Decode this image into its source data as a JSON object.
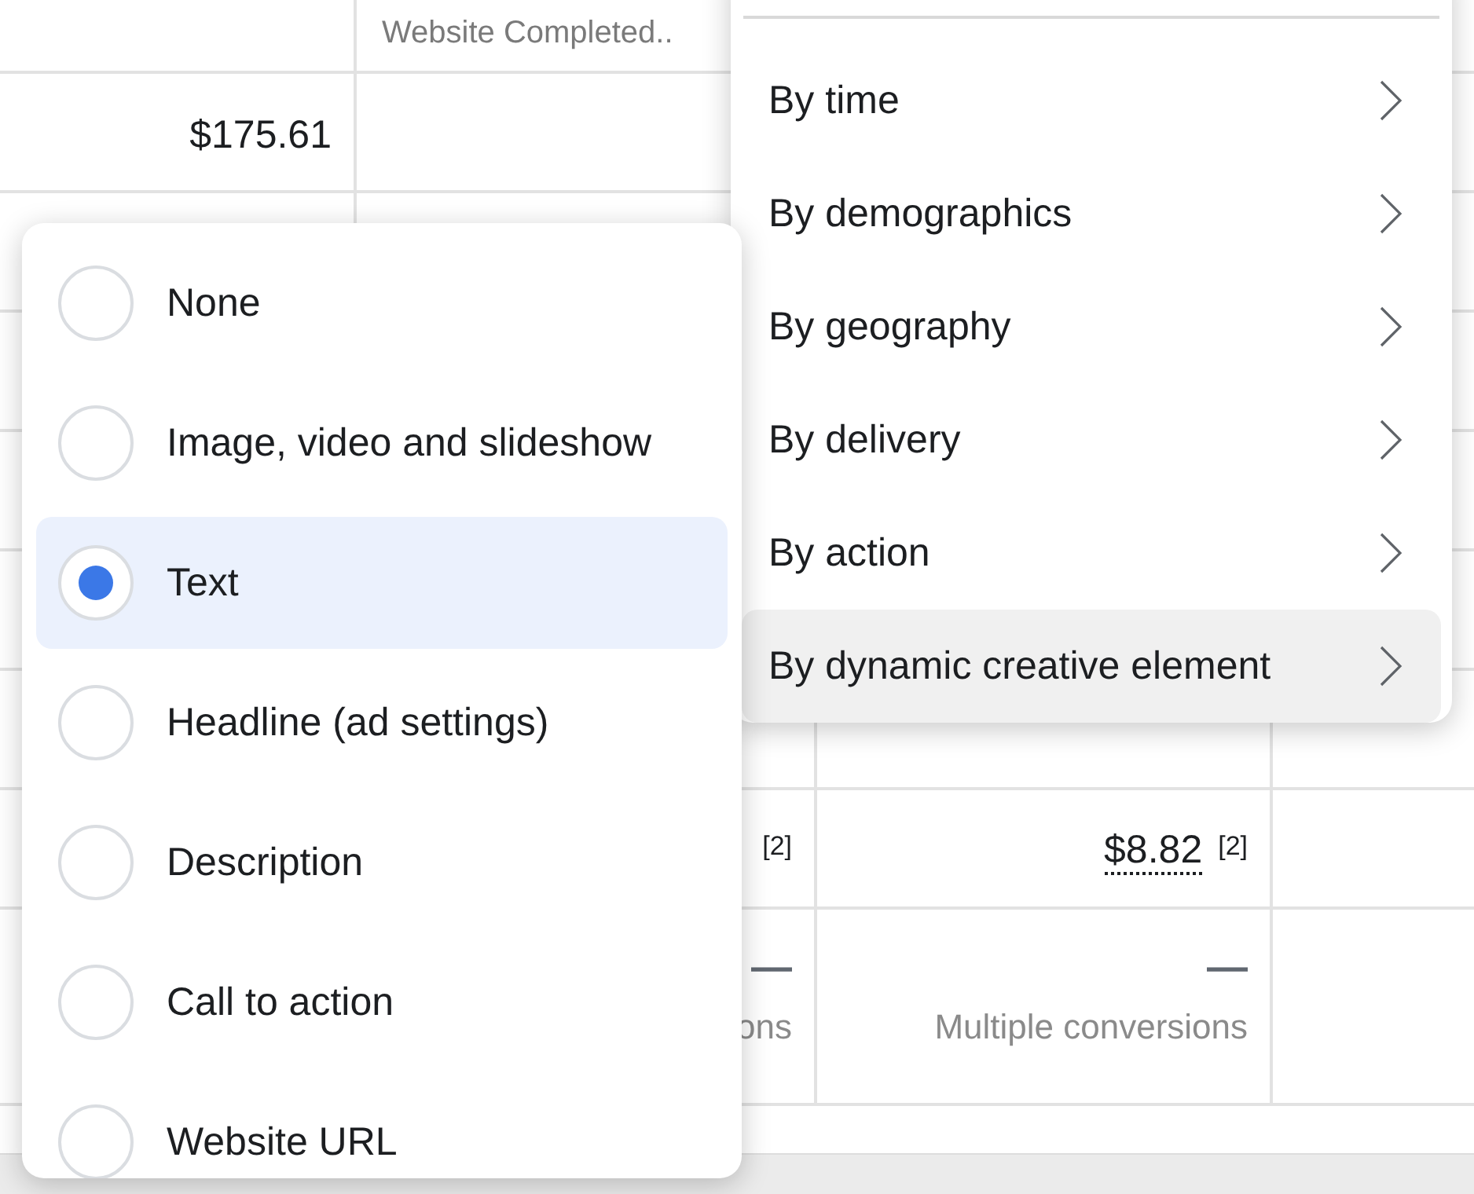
{
  "table": {
    "header": {
      "column_2": "Website Completed.."
    },
    "rows": [
      {
        "cells": [
          "$175.61",
          null,
          null,
          null
        ]
      },
      {
        "cells": [
          null,
          null,
          null,
          null
        ]
      },
      {
        "cells": [
          null,
          null,
          null,
          null
        ]
      },
      {
        "cells": [
          null,
          null,
          null,
          null
        ]
      },
      {
        "cells": [
          null,
          null,
          null,
          null
        ]
      },
      {
        "cells": [
          null,
          null,
          null,
          null
        ]
      },
      {
        "cells": [
          null,
          {
            "note": "[2]"
          },
          {
            "value": "$8.82",
            "note": "[2]"
          },
          null
        ]
      },
      {
        "cells": [
          null,
          {
            "dash": "—",
            "caption": "ons"
          },
          {
            "dash": "—",
            "caption": "Multiple conversions"
          },
          null
        ]
      }
    ]
  },
  "breakdown_menu": {
    "items": [
      {
        "label": "By time",
        "selected": false
      },
      {
        "label": "By demographics",
        "selected": false
      },
      {
        "label": "By geography",
        "selected": false
      },
      {
        "label": "By delivery",
        "selected": false
      },
      {
        "label": "By action",
        "selected": false
      },
      {
        "label": "By dynamic creative element",
        "selected": true
      }
    ]
  },
  "element_menu": {
    "items": [
      {
        "label": "None",
        "selected": false
      },
      {
        "label": "Image, video and slideshow",
        "selected": false
      },
      {
        "label": "Text",
        "selected": true
      },
      {
        "label": "Headline (ad settings)",
        "selected": false
      },
      {
        "label": "Description",
        "selected": false
      },
      {
        "label": "Call to action",
        "selected": false
      },
      {
        "label": "Website URL",
        "selected": false
      }
    ]
  }
}
